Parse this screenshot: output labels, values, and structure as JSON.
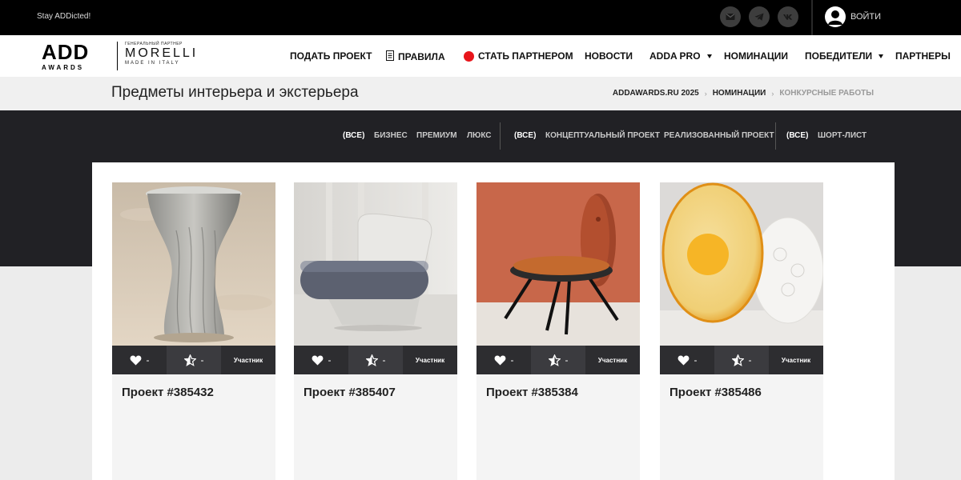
{
  "topbar": {
    "tagline": "Stay ADDicted!",
    "social": [
      "mail-icon",
      "telegram-icon",
      "vk-icon"
    ],
    "login_label": "ВОЙТИ"
  },
  "header": {
    "logo_main": "ADD",
    "logo_sub": "AWARDS",
    "partner_caption": "ГЕНЕРАЛЬНЫЙ ПАРТНЕР",
    "partner_name": "MORELLI",
    "partner_sub": "MADE IN ITALY",
    "nav": [
      {
        "label": "ПОДАТЬ ПРОЕКТ"
      },
      {
        "label": "ПРАВИЛА",
        "icon": "document-icon"
      },
      {
        "label": "СТАТЬ ПАРТНЕРОМ",
        "icon": "red-dot-icon"
      },
      {
        "label": "НОВОСТИ"
      },
      {
        "label": "ADDA PRO",
        "dropdown": true
      },
      {
        "label": "НОМИНАЦИИ"
      },
      {
        "label": "ПОБЕДИТЕЛИ",
        "dropdown": true
      },
      {
        "label": "ПАРТНЕРЫ"
      }
    ]
  },
  "page": {
    "title": "Предметы интерьера и экстерьера",
    "breadcrumb": [
      "ADDAWARDS.RU 2025",
      "НОМИНАЦИИ",
      "КОНКУРСНЫЕ РАБОТЫ"
    ]
  },
  "filters": {
    "group1": [
      "(ВСЕ)",
      "БИЗНЕС",
      "ПРЕМИУМ",
      "ЛЮКС"
    ],
    "group2": [
      "(ВСЕ)",
      "КОНЦЕПТУАЛЬНЫЙ ПРОЕКТ",
      "РЕАЛИЗОВАННЫЙ ПРОЕКТ"
    ],
    "group3": [
      "(ВСЕ)",
      "ШОРТ-ЛИСТ"
    ]
  },
  "cards": [
    {
      "title": "Проект #385432",
      "likes": "-",
      "rating": "-",
      "status": "Участник"
    },
    {
      "title": "Проект #385407",
      "likes": "-",
      "rating": "-",
      "status": "Участник"
    },
    {
      "title": "Проект #385384",
      "likes": "-",
      "rating": "-",
      "status": "Участник"
    },
    {
      "title": "Проект #385486",
      "likes": "-",
      "rating": "-",
      "status": "Участник"
    }
  ],
  "colors": {
    "topbar": "#000000",
    "dark_band": "#212125",
    "accent_red": "#e8151b",
    "card_bar": "#2d2d30"
  }
}
